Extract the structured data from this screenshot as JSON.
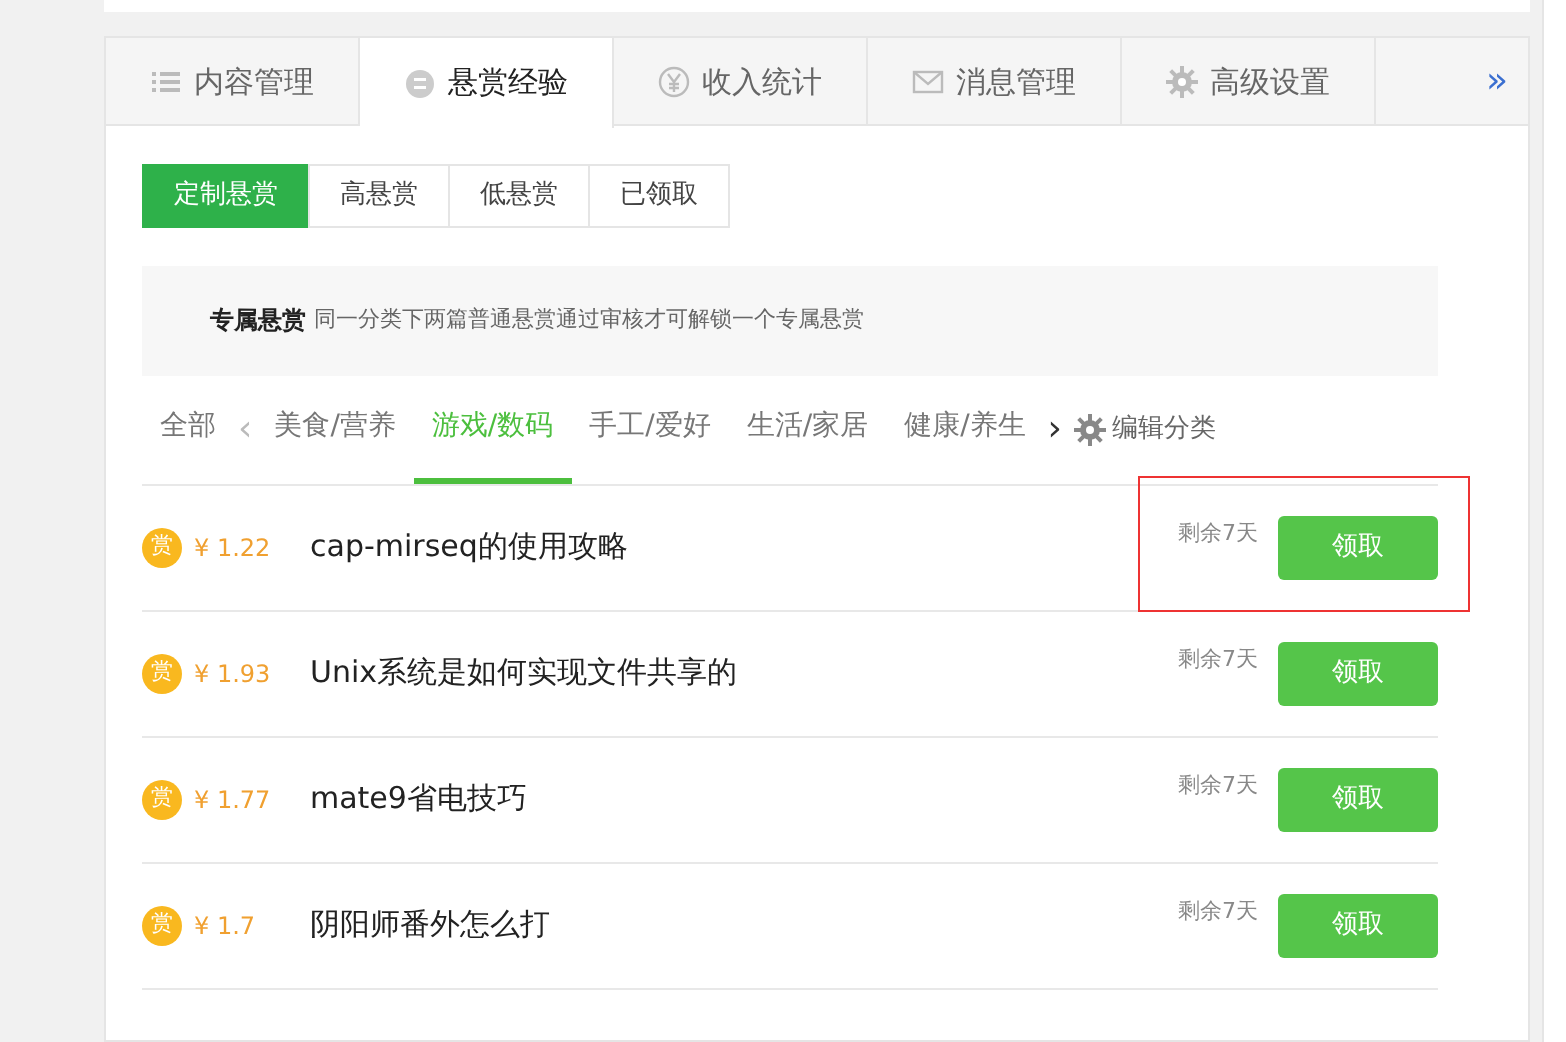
{
  "main_tabs": [
    {
      "label": "内容管理",
      "selected": false
    },
    {
      "label": "悬赏经验",
      "selected": true
    },
    {
      "label": "收入统计",
      "selected": false
    },
    {
      "label": "消息管理",
      "selected": false
    },
    {
      "label": "高级设置",
      "selected": false
    }
  ],
  "more_tabs": "»",
  "filters": [
    {
      "label": "定制悬赏",
      "selected": true
    },
    {
      "label": "高悬赏",
      "selected": false
    },
    {
      "label": "低悬赏",
      "selected": false
    },
    {
      "label": "已领取",
      "selected": false
    }
  ],
  "notice": {
    "title": "专属悬赏",
    "text": "同一分类下两篇普通悬赏通过审核才可解锁一个专属悬赏"
  },
  "categories": {
    "all": "全部",
    "prev": "‹",
    "items": [
      {
        "label": "美食/营养",
        "selected": false
      },
      {
        "label": "游戏/数码",
        "selected": true
      },
      {
        "label": "手工/爱好",
        "selected": false
      },
      {
        "label": "生活/家居",
        "selected": false
      },
      {
        "label": "健康/养生",
        "selected": false
      }
    ],
    "next": "›",
    "edit": "编辑分类"
  },
  "tasks": [
    {
      "badge": "赏",
      "price": "¥ 1.22",
      "title": "cap-mirseq的使用攻略",
      "remaining": "剩余7天",
      "button": "领取",
      "highlighted": true
    },
    {
      "badge": "赏",
      "price": "¥ 1.93",
      "title": "Unix系统是如何实现文件共享的",
      "remaining": "剩余7天",
      "button": "领取",
      "highlighted": false
    },
    {
      "badge": "赏",
      "price": "¥ 1.77",
      "title": "mate9省电技巧",
      "remaining": "剩余7天",
      "button": "领取",
      "highlighted": false
    },
    {
      "badge": "赏",
      "price": "¥ 1.7",
      "title": "阴阳师番外怎么打",
      "remaining": "剩余7天",
      "button": "领取",
      "highlighted": false
    }
  ]
}
